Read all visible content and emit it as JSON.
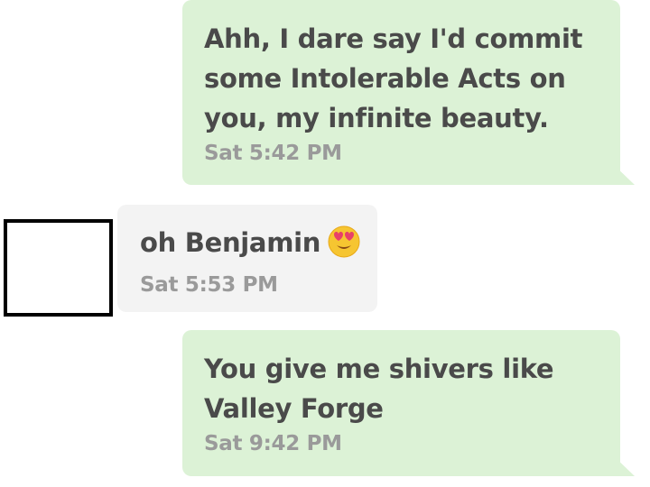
{
  "messages": [
    {
      "direction": "outgoing",
      "lines": [
        "Ahh, I dare say I'd commit",
        "some Intolerable Acts on",
        "you, my infinite beauty."
      ],
      "time": "Sat 5:42 PM"
    },
    {
      "direction": "incoming",
      "lines": [
        "oh Benjamin"
      ],
      "emoji": "heart-eyes-emoji-icon",
      "time": "Sat 5:53 PM"
    },
    {
      "direction": "outgoing",
      "lines": [
        "You give me shivers like",
        "Valley Forge"
      ],
      "time": "Sat 9:42 PM"
    }
  ],
  "colors": {
    "outgoing_bubble": "#dcf2d6",
    "incoming_bubble": "#f3f3f3",
    "message_text": "#4a4a4a",
    "timestamp_text": "#9a9a9a",
    "avatar_border": "#000000"
  }
}
